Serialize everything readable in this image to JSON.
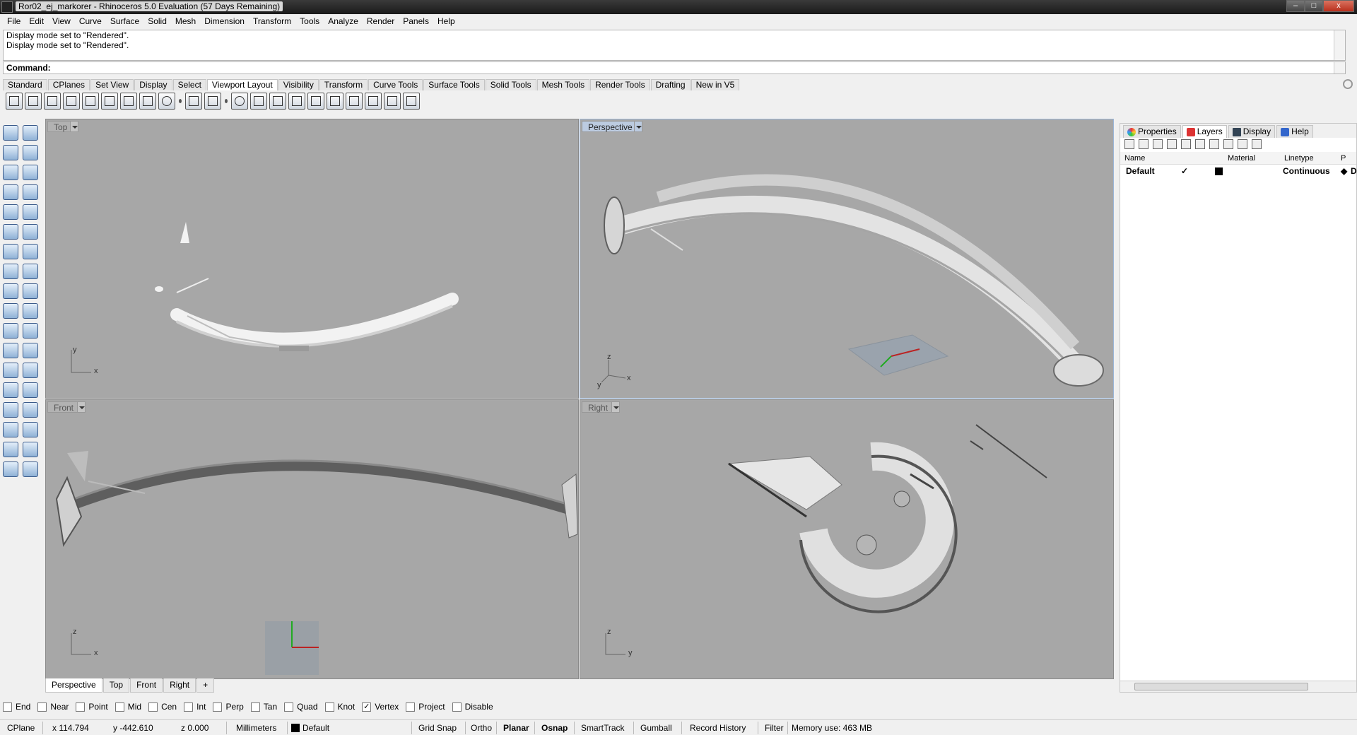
{
  "window": {
    "title": "Ror02_ej_markorer - Rhinoceros 5.0 Evaluation (57 Days Remaining)",
    "controls": [
      "–",
      "□",
      "x"
    ]
  },
  "menu": [
    "File",
    "Edit",
    "View",
    "Curve",
    "Surface",
    "Solid",
    "Mesh",
    "Dimension",
    "Transform",
    "Tools",
    "Analyze",
    "Render",
    "Panels",
    "Help"
  ],
  "command": {
    "history": [
      "Display mode set to \"Rendered\".",
      "Display mode set to \"Rendered\"."
    ],
    "prompt": "Command:"
  },
  "toolbar_tabs": [
    "Standard",
    "CPlanes",
    "Set View",
    "Display",
    "Select",
    "Viewport Layout",
    "Visibility",
    "Transform",
    "Curve Tools",
    "Surface Tools",
    "Solid Tools",
    "Mesh Tools",
    "Render Tools",
    "Drafting",
    "New in V5"
  ],
  "toolbar_active_tab": "Viewport Layout",
  "viewports": {
    "top": {
      "label": "Top",
      "axis1": "y",
      "axis2": "x"
    },
    "perspective": {
      "label": "Perspective",
      "axis1": "z",
      "axis2": "x",
      "axis3": "y"
    },
    "front": {
      "label": "Front",
      "axis1": "z",
      "axis2": "x"
    },
    "right": {
      "label": "Right",
      "axis1": "z",
      "axis2": "y"
    }
  },
  "viewport_tabs": [
    "Perspective",
    "Top",
    "Front",
    "Right",
    "+"
  ],
  "panel": {
    "tabs": [
      "Properties",
      "Layers",
      "Display",
      "Help"
    ],
    "active_tab": "Layers",
    "columns": [
      "Name",
      "Material",
      "Linetype",
      "P"
    ],
    "layer": {
      "name": "Default",
      "current": "✓",
      "linetype": "Continuous",
      "print": "D"
    }
  },
  "osnaps": [
    {
      "label": "End",
      "checked": false
    },
    {
      "label": "Near",
      "checked": false
    },
    {
      "label": "Point",
      "checked": false
    },
    {
      "label": "Mid",
      "checked": false
    },
    {
      "label": "Cen",
      "checked": false
    },
    {
      "label": "Int",
      "checked": false
    },
    {
      "label": "Perp",
      "checked": false
    },
    {
      "label": "Tan",
      "checked": false
    },
    {
      "label": "Quad",
      "checked": false
    },
    {
      "label": "Knot",
      "checked": false
    },
    {
      "label": "Vertex",
      "checked": true
    },
    {
      "label": "Project",
      "checked": false
    },
    {
      "label": "Disable",
      "checked": false
    }
  ],
  "status": {
    "cplane": "CPlane",
    "x": "x 114.794",
    "y": "y -442.610",
    "z": "z 0.000",
    "units": "Millimeters",
    "layer": "Default",
    "grid_snap": "Grid Snap",
    "ortho": "Ortho",
    "planar": "Planar",
    "osnap": "Osnap",
    "smarttrack": "SmartTrack",
    "gumball": "Gumball",
    "record_history": "Record History",
    "filter": "Filter",
    "memory": "Memory use: 463 MB"
  }
}
